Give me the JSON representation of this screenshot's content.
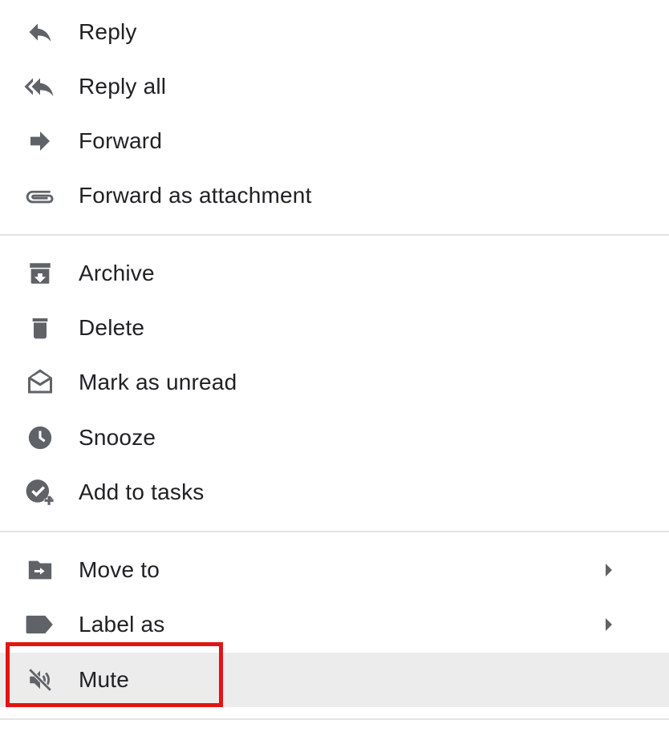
{
  "menu": {
    "items": [
      {
        "label": "Reply",
        "icon": "reply-icon"
      },
      {
        "label": "Reply all",
        "icon": "reply-all-icon"
      },
      {
        "label": "Forward",
        "icon": "forward-icon"
      },
      {
        "label": "Forward as attachment",
        "icon": "attachment-icon"
      },
      {
        "label": "Archive",
        "icon": "archive-icon"
      },
      {
        "label": "Delete",
        "icon": "trash-icon"
      },
      {
        "label": "Mark as unread",
        "icon": "mark-unread-icon"
      },
      {
        "label": "Snooze",
        "icon": "clock-icon"
      },
      {
        "label": "Add to tasks",
        "icon": "add-task-icon"
      },
      {
        "label": "Move to",
        "icon": "move-to-folder-icon",
        "submenu": true
      },
      {
        "label": "Label as",
        "icon": "label-icon",
        "submenu": true
      },
      {
        "label": "Mute",
        "icon": "mute-icon",
        "highlighted": true
      }
    ]
  },
  "colors": {
    "icon": "#5f6368",
    "text": "#202124",
    "divider": "#e3e3e3",
    "hover_background": "#ececec",
    "annotation_box": "#e31414"
  }
}
